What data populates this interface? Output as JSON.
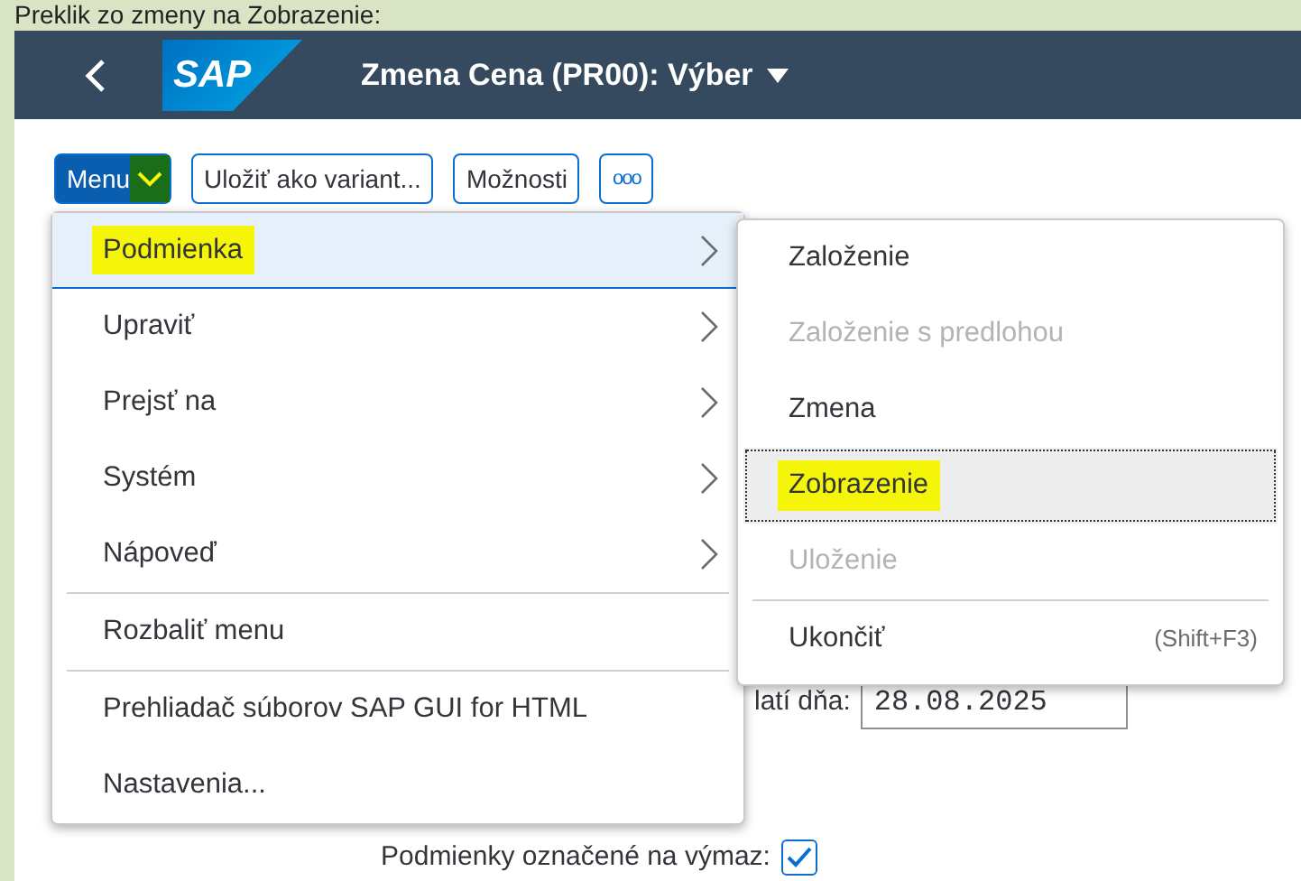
{
  "caption": "Preklik zo zmeny na Zobrazenie:",
  "shell": {
    "title": "Zmena Cena (PR00): Výber",
    "logo": "SAP"
  },
  "toolbar": [
    {
      "kind": "menu",
      "label": "Menu",
      "highlighted": true
    },
    {
      "kind": "button",
      "label": "Uložiť ako variant..."
    },
    {
      "kind": "button",
      "label": "Možnosti"
    },
    {
      "kind": "overflow",
      "label": "ooo"
    }
  ],
  "menu": {
    "groups": [
      [
        {
          "label": "Podmienka",
          "submenu": true,
          "selected": true,
          "highlighted": true
        },
        {
          "label": "Upraviť",
          "submenu": true,
          "selected": false,
          "highlighted": false
        },
        {
          "label": "Prejsť na",
          "submenu": true,
          "selected": false,
          "highlighted": false
        },
        {
          "label": "Systém",
          "submenu": true,
          "selected": false,
          "highlighted": false
        },
        {
          "label": "Nápoveď",
          "submenu": true,
          "selected": false,
          "highlighted": false
        }
      ],
      [
        {
          "label": "Rozbaliť menu",
          "submenu": false,
          "selected": false,
          "highlighted": false
        }
      ],
      [
        {
          "label": "Prehliadač súborov SAP GUI for HTML",
          "submenu": false,
          "selected": false,
          "highlighted": false
        },
        {
          "label": "Nastavenia...",
          "submenu": false,
          "selected": false,
          "highlighted": false
        }
      ]
    ]
  },
  "submenu": {
    "groups": [
      [
        {
          "label": "Založenie",
          "disabled": false,
          "selected": false,
          "highlighted": false
        },
        {
          "label": "Založenie s predlohou",
          "disabled": true,
          "selected": false,
          "highlighted": false
        },
        {
          "label": "Zmena",
          "disabled": false,
          "selected": false,
          "highlighted": false
        },
        {
          "label": "Zobrazenie",
          "disabled": false,
          "selected": true,
          "highlighted": true
        },
        {
          "label": "Uloženie",
          "disabled": true,
          "selected": false,
          "highlighted": false
        }
      ],
      [
        {
          "label": "Ukončiť",
          "shortcut": "(Shift+F3)",
          "disabled": false,
          "selected": false,
          "highlighted": false
        }
      ]
    ]
  },
  "form": {
    "date_label": "latí dňa:",
    "date_value": "28.08.2025",
    "deleted_label": "Podmienky označené na výmaz:",
    "deleted_checked": true
  }
}
